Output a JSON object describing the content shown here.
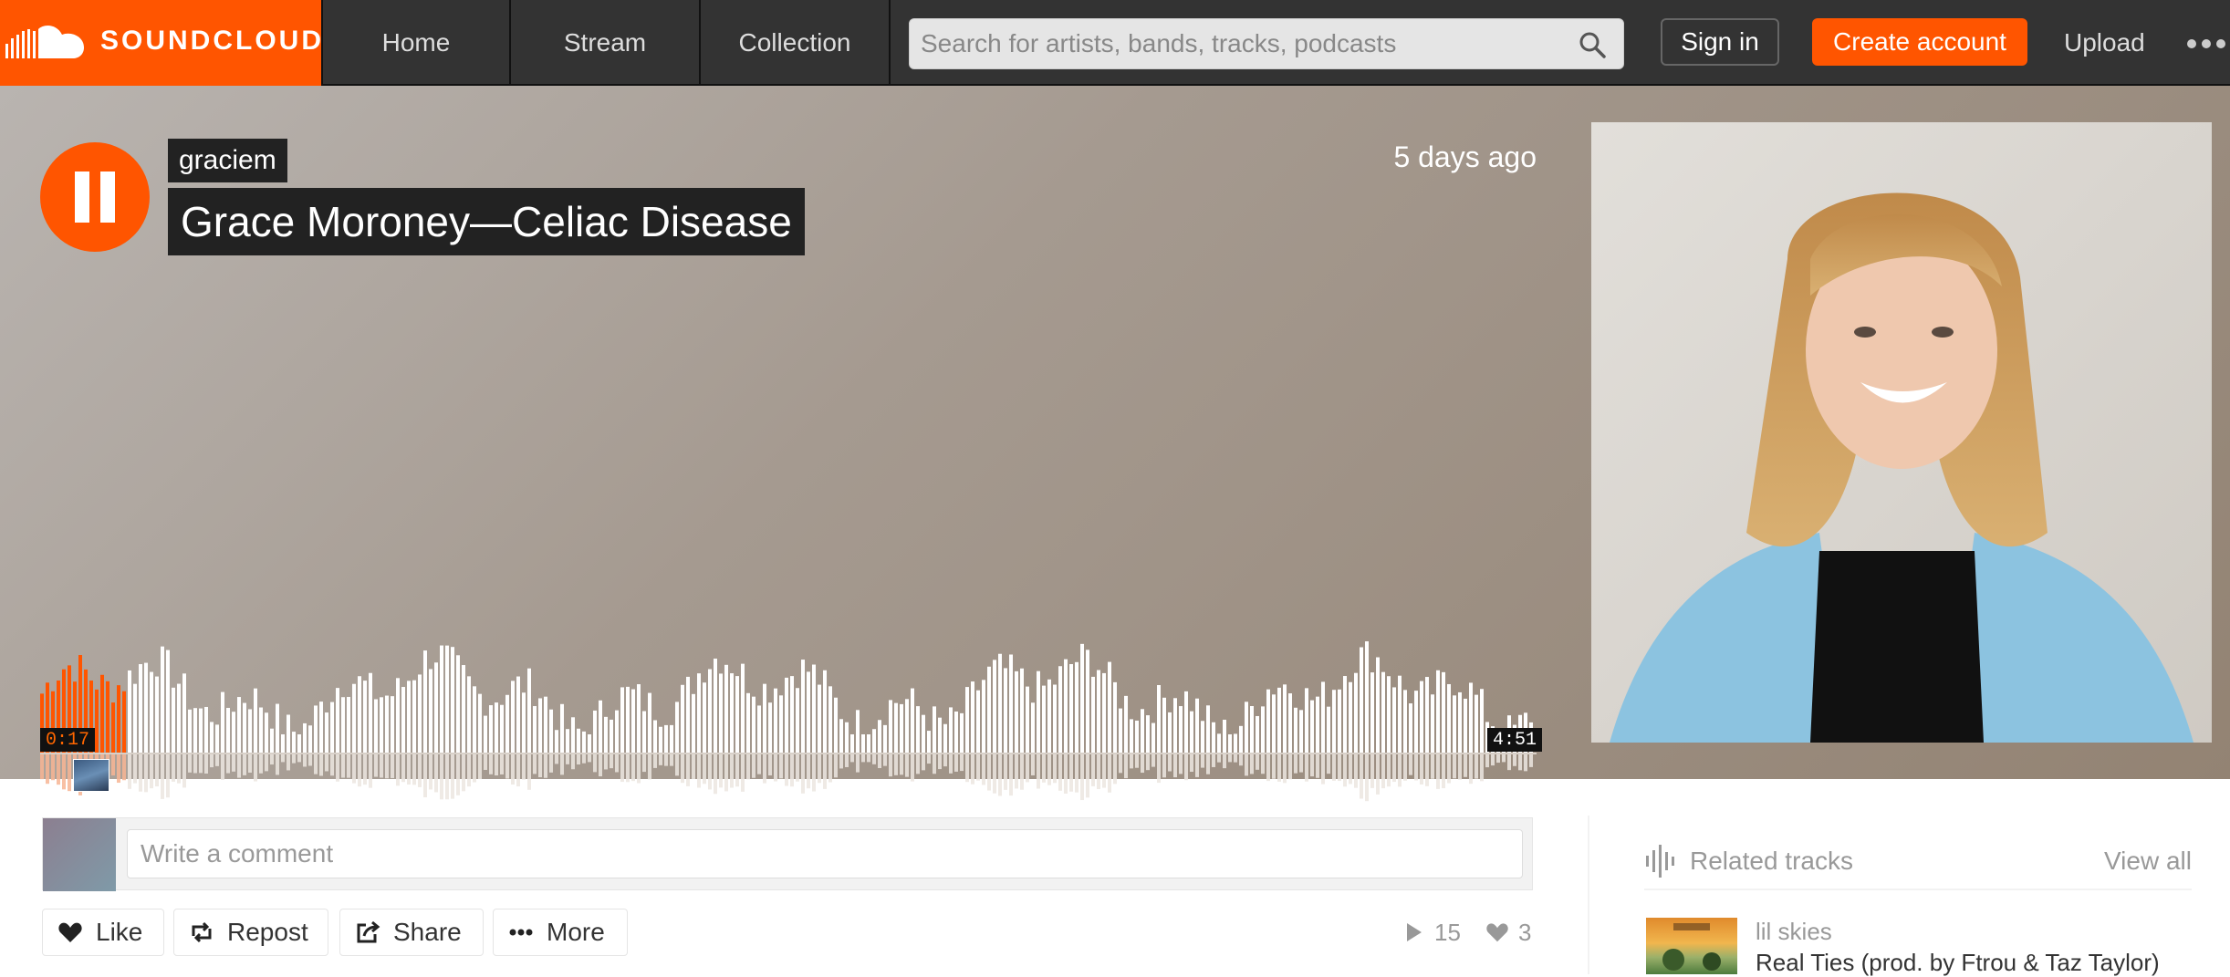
{
  "brand": {
    "name": "SOUNDCLOUD",
    "accent": "#ff5500"
  },
  "nav": {
    "tabs": [
      {
        "label": "Home"
      },
      {
        "label": "Stream"
      },
      {
        "label": "Collection"
      }
    ],
    "search_placeholder": "Search for artists, bands, tracks, podcasts",
    "sign_in": "Sign in",
    "create_account": "Create account",
    "upload": "Upload"
  },
  "track": {
    "artist": "graciem",
    "title": "Grace Moroney—Celiac Disease",
    "posted": "5 days ago",
    "current_time": "0:17",
    "duration": "4:51",
    "progress": 0.058,
    "state": "playing"
  },
  "comment": {
    "placeholder": "Write a comment"
  },
  "actions": {
    "like": "Like",
    "repost": "Repost",
    "share": "Share",
    "more": "More"
  },
  "stats": {
    "plays": "15",
    "likes": "3"
  },
  "related": {
    "title": "Related tracks",
    "view_all": "View all",
    "items": [
      {
        "artist": "lil skies",
        "title": "Real Ties (prod. by Ftrou & Taz Taylor)"
      }
    ]
  }
}
